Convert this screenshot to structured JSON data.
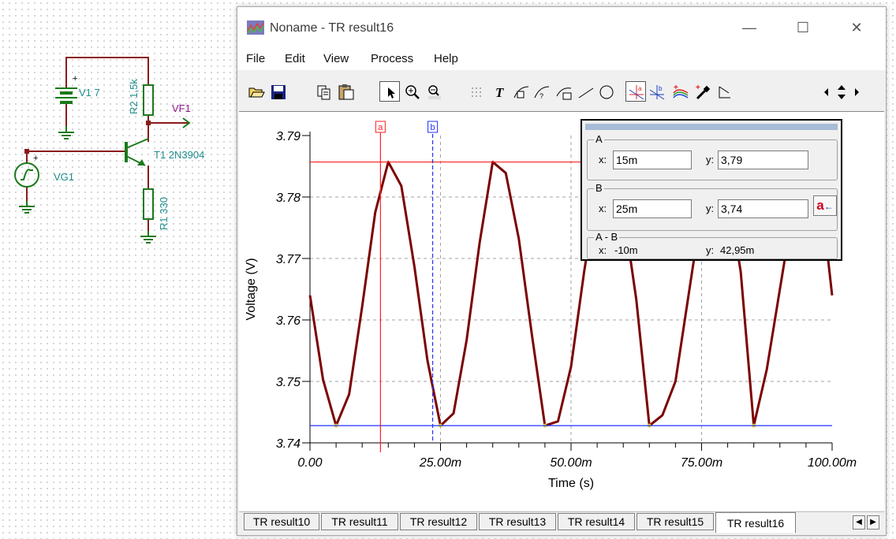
{
  "schematic": {
    "labels": {
      "v1": "V1 7",
      "r2": "R2 1,5k",
      "vf1": "VF1",
      "t1": "T1 2N3904",
      "vg1": "VG1",
      "r1": "R1 330"
    }
  },
  "window": {
    "title": "Noname - TR result16",
    "controls": {
      "minimize": "—",
      "maximize": "☐",
      "close": "✕"
    }
  },
  "menu": [
    "File",
    "Edit",
    "View",
    "Process",
    "Help"
  ],
  "toolbar": {
    "icons": [
      "open-icon",
      "save-icon",
      "copy-icon",
      "paste-icon",
      "pointer-icon",
      "zoom-in-icon",
      "zoom-100-icon",
      "grid-icon",
      "text-icon",
      "curve-label-icon",
      "curve-label-q-icon",
      "equation-icon",
      "line-icon",
      "circle-icon",
      "cursor-a-icon",
      "cursor-b-icon",
      "add-curve-icon",
      "color-picker-icon",
      "marker-icon",
      "scroll-left-icon",
      "scroll-updown-icon",
      "scroll-right-icon"
    ]
  },
  "cursor_panel": {
    "a": {
      "title": "A",
      "x_label": "x:",
      "x_value": "15m",
      "y_label": "y:",
      "y_value": "3,79"
    },
    "b": {
      "title": "B",
      "x_label": "x:",
      "x_value": "25m",
      "y_label": "y:",
      "y_value": "3,74",
      "button_text": "a",
      "button_arrow": "←"
    },
    "diff": {
      "title": "A - B",
      "x_label": "x:",
      "x_value": "-10m",
      "y_label": "y:",
      "y_value": "42,95m"
    }
  },
  "cursor_markers": {
    "a": "a",
    "b": "b"
  },
  "tabs": [
    "TR result10",
    "TR result11",
    "TR result12",
    "TR result13",
    "TR result14",
    "TR result15",
    "TR result16"
  ],
  "active_tab": "TR result16",
  "chart_data": {
    "type": "line",
    "xlabel": "Time (s)",
    "ylabel": "Voltage (V)",
    "xlim": [
      0,
      100
    ],
    "ylim": [
      3.74,
      3.79
    ],
    "x_ticks": [
      {
        "value": 0,
        "label": "0.00"
      },
      {
        "value": 25,
        "label": "25.00m"
      },
      {
        "value": 50,
        "label": "50.00m"
      },
      {
        "value": 75,
        "label": "75.00m"
      },
      {
        "value": 100,
        "label": "100.00m"
      }
    ],
    "y_ticks": [
      {
        "value": 3.79,
        "label": "3.79"
      },
      {
        "value": 3.78,
        "label": "3.78"
      },
      {
        "value": 3.77,
        "label": "3.77"
      },
      {
        "value": 3.76,
        "label": "3.76"
      },
      {
        "value": 3.75,
        "label": "3.75"
      },
      {
        "value": 3.74,
        "label": "3.74"
      }
    ],
    "grid": true,
    "series": [
      {
        "color": "#7b0000",
        "x": [
          0,
          2.5,
          5,
          7.5,
          10,
          12.5,
          15,
          17.5,
          20,
          22.5,
          25,
          27.5,
          30,
          32.5,
          35,
          37.5,
          40,
          42.5,
          45,
          47.5,
          50,
          52.5,
          55,
          57.5,
          60,
          62.5,
          65,
          67.5,
          70,
          72.5,
          75,
          77.5,
          80,
          82.5,
          85,
          87.5,
          90,
          92.5,
          95,
          97.5,
          100
        ],
        "y": [
          3.764,
          3.7503,
          3.7428,
          3.7479,
          3.7622,
          3.7775,
          3.7857,
          3.7818,
          3.7687,
          3.7534,
          3.7428,
          3.7448,
          3.7567,
          3.7726,
          3.7857,
          3.7839,
          3.7732,
          3.7576,
          3.7428,
          3.7435,
          3.7524,
          3.7678,
          3.7812,
          3.7857,
          3.778,
          3.7633,
          3.7428,
          3.7445,
          3.75,
          3.764,
          3.778,
          3.7857,
          3.7812,
          3.7678,
          3.7428,
          3.752,
          3.765,
          3.778,
          3.7857,
          3.783,
          3.764
        ]
      }
    ],
    "cursor_a": {
      "x": 13.5,
      "y": 3.7857,
      "color": "#ff2020"
    },
    "cursor_b": {
      "x": 23.5,
      "y": 3.7428,
      "color": "#2030ff"
    }
  }
}
